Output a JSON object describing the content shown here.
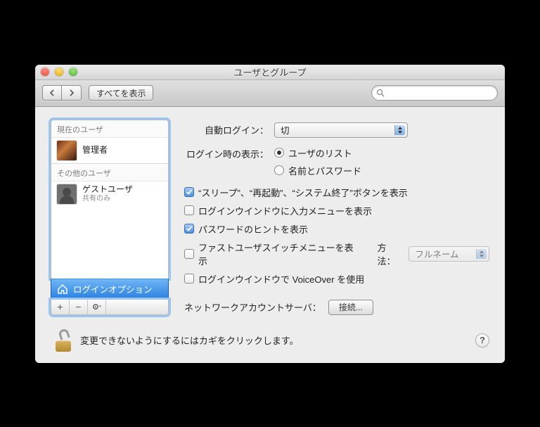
{
  "window": {
    "title": "ユーザとグループ"
  },
  "toolbar": {
    "show_all": "すべてを表示"
  },
  "sidebar": {
    "current_header": "現在のユーザ",
    "other_header": "その他のユーザ",
    "admin_label": "管理者",
    "guest_label": "ゲストユーザ",
    "guest_sub": "共有のみ",
    "login_options": "ログインオプション"
  },
  "main": {
    "auto_login_label": "自動ログイン：",
    "auto_login_value": "切",
    "display_label": "ログイン時の表示：",
    "radio_list": "ユーザのリスト",
    "radio_namepw": "名前とパスワード",
    "cb_buttons": "“スリープ”、“再起動”、“システム終了”ボタンを表示",
    "cb_inputmenu": "ログインウインドウに入力メニューを表示",
    "cb_hint": "パスワードのヒントを表示",
    "cb_fastswitch": "ファストユーザスイッチメニューを表示",
    "fast_method_label": "方法：",
    "fast_method_value": "フルネーム",
    "cb_voiceover": "ログインウインドウで VoiceOver を使用",
    "network_label": "ネットワークアカウントサーバ：",
    "connect_btn": "接続..."
  },
  "footer": {
    "lock_text": "変更できないようにするにはカギをクリックします。"
  },
  "state": {
    "radio_selected": "list",
    "cb_buttons": true,
    "cb_inputmenu": false,
    "cb_hint": true,
    "cb_fastswitch": false,
    "cb_voiceover": false
  }
}
